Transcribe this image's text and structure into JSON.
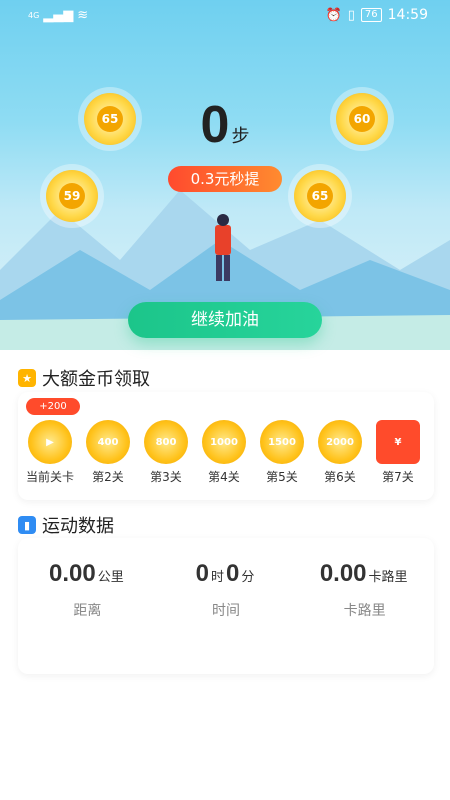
{
  "status": {
    "network": "4G",
    "battery": "76",
    "time": "14:59"
  },
  "steps": {
    "value": "0",
    "unit": "步",
    "withdraw_label": "0.3元秒提"
  },
  "bubbles": [
    "65",
    "60",
    "59",
    "65"
  ],
  "main_button": "继续加油",
  "bonus": {
    "title": "大额金币领取",
    "badge": "+200",
    "items": [
      {
        "label": "当前关卡",
        "value": ""
      },
      {
        "label": "第2关",
        "value": "400"
      },
      {
        "label": "第3关",
        "value": "800"
      },
      {
        "label": "第4关",
        "value": "1000"
      },
      {
        "label": "第5关",
        "value": "1500"
      },
      {
        "label": "第6关",
        "value": "2000"
      },
      {
        "label": "第7关",
        "value": "¥"
      }
    ]
  },
  "sport": {
    "title": "运动数据",
    "distance": {
      "value": "0.00",
      "unit": "公里",
      "label": "距离"
    },
    "time": {
      "hours": "0",
      "hours_unit": "时",
      "minutes": "0",
      "minutes_unit": "分",
      "label": "时间"
    },
    "calories": {
      "value": "0.00",
      "unit": "卡路里",
      "label": "卡路里"
    }
  },
  "colors": {
    "accent_green": "#1cc58a",
    "accent_orange": "#ff5a2e",
    "coin_gold": "#ffc21a"
  }
}
